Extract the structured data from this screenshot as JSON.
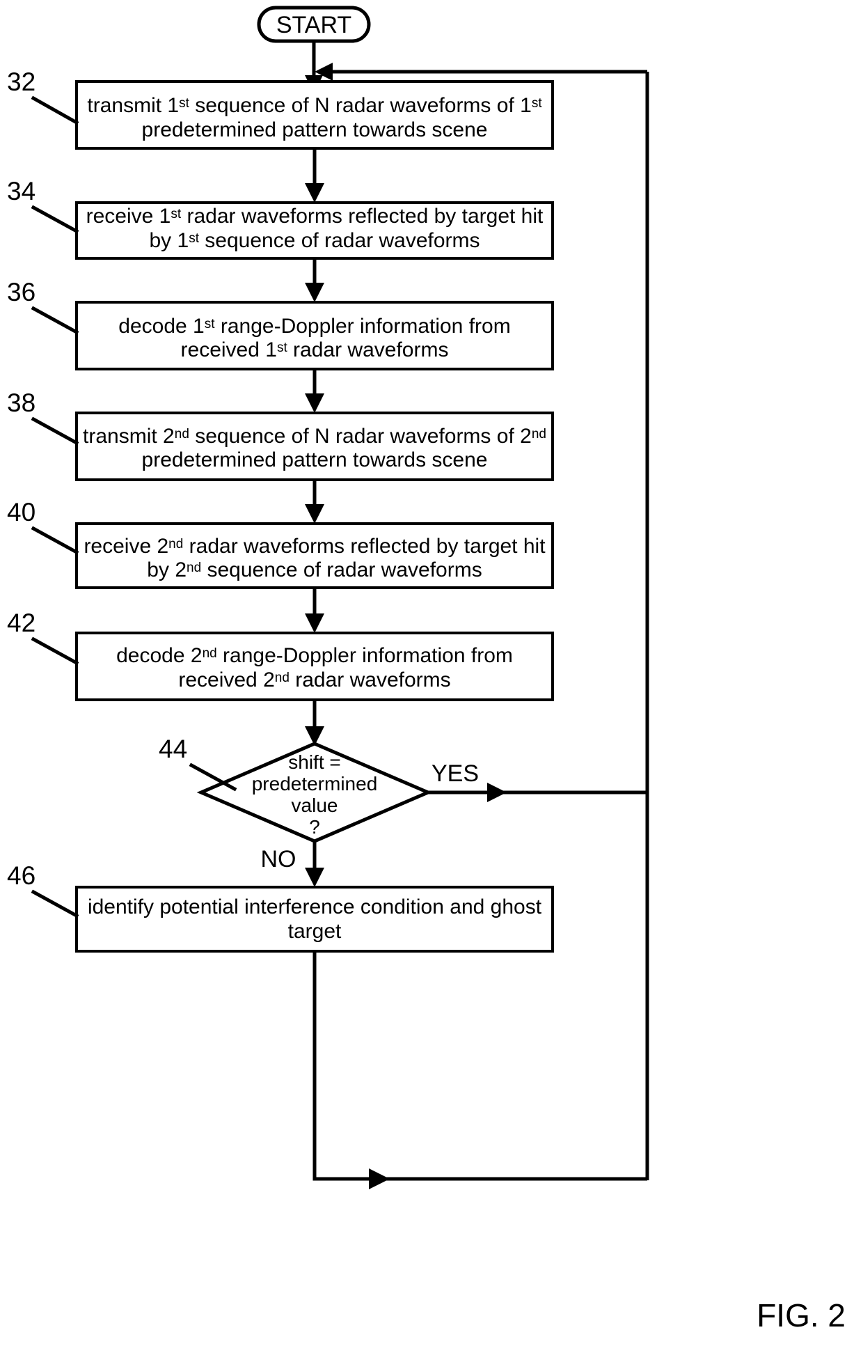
{
  "figure": {
    "caption": "FIG. 2",
    "start_label": "START"
  },
  "nodes": [
    {
      "ref": "32",
      "type": "process",
      "lines": [
        [
          {
            "t": "transmit 1"
          },
          {
            "t": "st",
            "sup": true
          },
          {
            "t": " sequence of N radar waveforms of 1"
          },
          {
            "t": "st",
            "sup": true
          }
        ],
        [
          {
            "t": "predetermined pattern towards scene"
          }
        ]
      ],
      "plain": "transmit 1st sequence of N radar waveforms of 1st predetermined pattern towards scene"
    },
    {
      "ref": "34",
      "type": "process",
      "lines": [
        [
          {
            "t": "receive 1"
          },
          {
            "t": "st",
            "sup": true
          },
          {
            "t": " radar waveforms reflected by target  hit"
          }
        ],
        [
          {
            "t": "by 1"
          },
          {
            "t": "st",
            "sup": true
          },
          {
            "t": " sequence of radar waveforms"
          }
        ]
      ],
      "plain": "receive 1st radar waveforms reflected by target hit by 1st sequence of radar waveforms"
    },
    {
      "ref": "36",
      "type": "process",
      "lines": [
        [
          {
            "t": "decode 1"
          },
          {
            "t": "st",
            "sup": true
          },
          {
            "t": " range-Doppler information from"
          }
        ],
        [
          {
            "t": "received 1"
          },
          {
            "t": "st",
            "sup": true
          },
          {
            "t": " radar waveforms"
          }
        ]
      ],
      "plain": "decode 1st range-Doppler information from received 1st radar waveforms"
    },
    {
      "ref": "38",
      "type": "process",
      "lines": [
        [
          {
            "t": "transmit 2"
          },
          {
            "t": "nd",
            "sup": true
          },
          {
            "t": " sequence of N radar waveforms of 2"
          },
          {
            "t": "nd",
            "sup": true
          }
        ],
        [
          {
            "t": "predetermined pattern towards scene"
          }
        ]
      ],
      "plain": "transmit 2nd sequence of N radar waveforms of 2nd predetermined pattern towards scene"
    },
    {
      "ref": "40",
      "type": "process",
      "lines": [
        [
          {
            "t": "receive 2"
          },
          {
            "t": "nd",
            "sup": true
          },
          {
            "t": " radar waveforms reflected by target hit"
          }
        ],
        [
          {
            "t": "by 2"
          },
          {
            "t": "nd",
            "sup": true
          },
          {
            "t": " sequence of radar waveforms"
          }
        ]
      ],
      "plain": "receive 2nd radar waveforms reflected by target hit by 2nd sequence of radar waveforms"
    },
    {
      "ref": "42",
      "type": "process",
      "lines": [
        [
          {
            "t": "decode 2"
          },
          {
            "t": "nd",
            "sup": true
          },
          {
            "t": " range-Doppler information from"
          }
        ],
        [
          {
            "t": "received 2"
          },
          {
            "t": "nd",
            "sup": true
          },
          {
            "t": " radar waveforms"
          }
        ]
      ],
      "plain": "decode 2nd range-Doppler information from received 2nd radar waveforms"
    },
    {
      "ref": "44",
      "type": "decision",
      "lines": [
        [
          {
            "t": "shift ="
          }
        ],
        [
          {
            "t": "predetermined"
          }
        ],
        [
          {
            "t": "value"
          }
        ],
        [
          {
            "t": "?"
          }
        ]
      ],
      "plain": "shift = predetermined value ?"
    },
    {
      "ref": "46",
      "type": "process",
      "lines": [
        [
          {
            "t": "identify potential interference condition and ghost"
          }
        ],
        [
          {
            "t": "target"
          }
        ]
      ],
      "plain": "identify potential interference condition and ghost target"
    }
  ],
  "branches": {
    "yes": "YES",
    "no": "NO"
  },
  "colors": {
    "ink": "#000000",
    "paper": "#ffffff"
  }
}
